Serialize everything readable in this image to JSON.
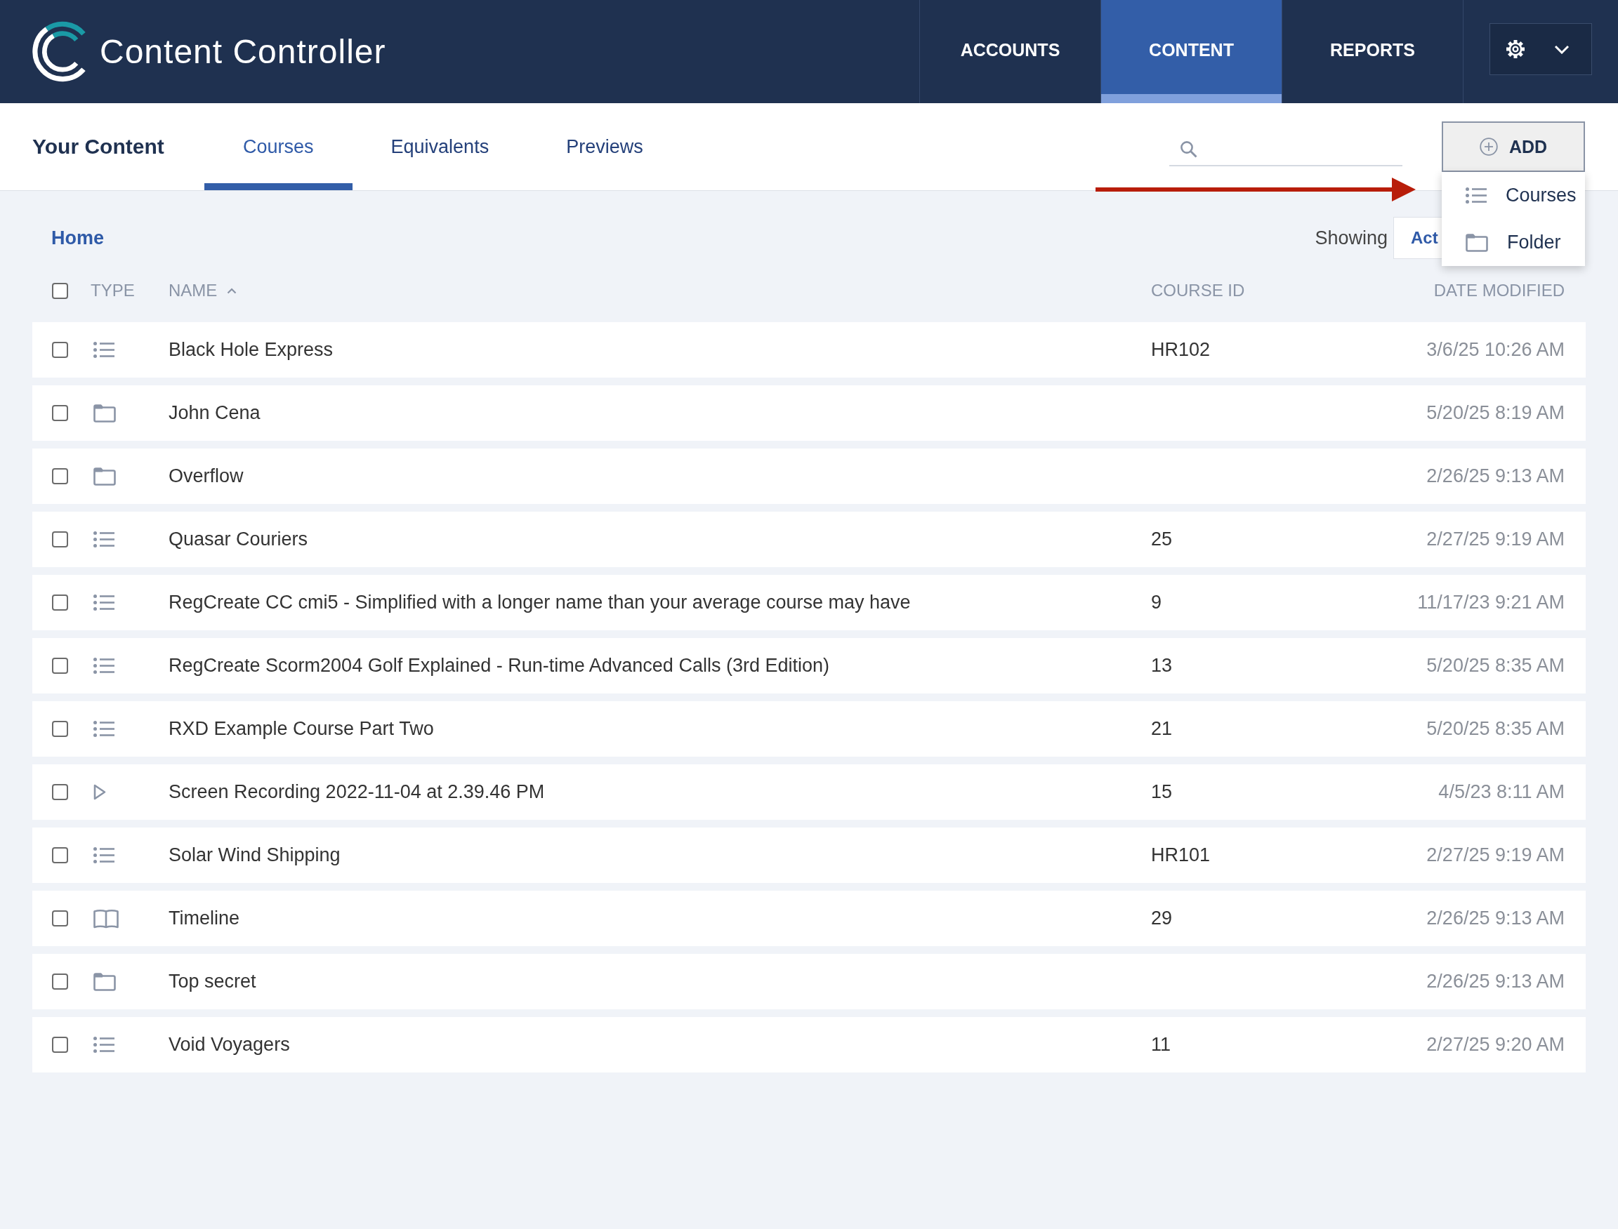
{
  "header": {
    "logo_text": "Content Controller",
    "nav": [
      {
        "label": "ACCOUNTS",
        "selected": false
      },
      {
        "label": "CONTENT",
        "selected": true
      },
      {
        "label": "REPORTS",
        "selected": false
      }
    ]
  },
  "subheader": {
    "title": "Your Content",
    "tabs": [
      {
        "label": "Courses",
        "selected": true
      },
      {
        "label": "Equivalents",
        "selected": false
      },
      {
        "label": "Previews",
        "selected": false
      }
    ],
    "add_button": {
      "label": "ADD"
    },
    "add_menu": {
      "expanded": true,
      "items": [
        {
          "kind": "list",
          "label": "Courses"
        },
        {
          "kind": "folder",
          "label": "Folder"
        }
      ]
    }
  },
  "breadcrumb": "Home",
  "filter": {
    "label": "Showing",
    "value": "Act"
  },
  "table": {
    "select_all": {
      "checked": false
    },
    "columns": [
      {
        "label": "TYPE",
        "sorted": false
      },
      {
        "label": "NAME",
        "sorted": true
      },
      {
        "label": "COURSE ID",
        "sorted": false
      },
      {
        "label": "DATE MODIFIED",
        "sorted": false
      }
    ],
    "rows": [
      {
        "checked": false,
        "kind": "list",
        "name": "Black Hole Express",
        "course_id": "HR102",
        "date_modified": "3/6/25 10:26 AM"
      },
      {
        "checked": false,
        "kind": "folder",
        "name": "John Cena",
        "date_modified": "5/20/25 8:19 AM"
      },
      {
        "checked": false,
        "kind": "folder",
        "name": "Overflow",
        "date_modified": "2/26/25 9:13 AM"
      },
      {
        "checked": false,
        "kind": "list",
        "name": "Quasar Couriers",
        "course_id": "25",
        "date_modified": "2/27/25 9:19 AM"
      },
      {
        "checked": false,
        "kind": "list",
        "name": "RegCreate CC cmi5 - Simplified with a longer name than your average course may have",
        "course_id": "9",
        "date_modified": "11/17/23 9:21 AM"
      },
      {
        "checked": false,
        "kind": "list",
        "name": "RegCreate Scorm2004 Golf Explained - Run-time Advanced Calls (3rd Edition)",
        "course_id": "13",
        "date_modified": "5/20/25 8:35 AM"
      },
      {
        "checked": false,
        "kind": "list",
        "name": "RXD Example Course Part Two",
        "course_id": "21",
        "date_modified": "5/20/25 8:35 AM"
      },
      {
        "checked": false,
        "kind": "play",
        "name": "Screen Recording 2022-11-04 at 2.39.46 PM",
        "course_id": "15",
        "date_modified": "4/5/23 8:11 AM"
      },
      {
        "checked": false,
        "kind": "list",
        "name": "Solar Wind Shipping",
        "course_id": "HR101",
        "date_modified": "2/27/25 9:19 AM"
      },
      {
        "checked": false,
        "kind": "book",
        "name": "Timeline",
        "course_id": "29",
        "date_modified": "2/26/25 9:13 AM"
      },
      {
        "checked": false,
        "kind": "folder",
        "name": "Top secret",
        "date_modified": "2/26/25 9:13 AM"
      },
      {
        "checked": false,
        "kind": "list",
        "name": "Void Voyagers",
        "course_id": "11",
        "date_modified": "2/27/25 9:20 AM"
      }
    ]
  }
}
